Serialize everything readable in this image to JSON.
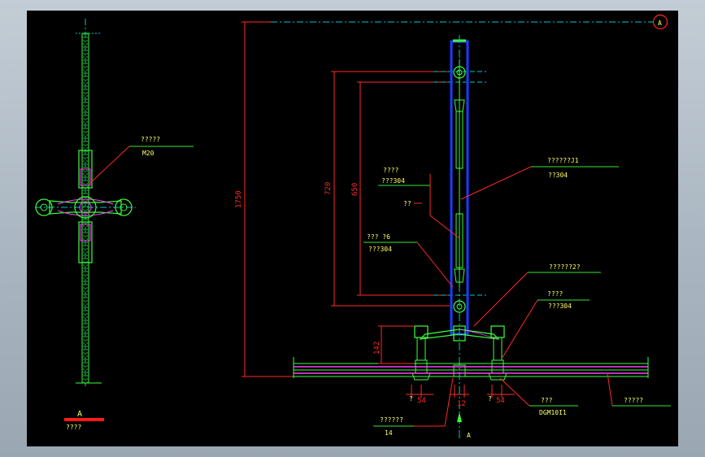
{
  "colors": {
    "background": "#000000",
    "frame": "#b7c2cc",
    "dimension": "#ff2a2a",
    "leader": "#ff2a2a",
    "text": "#ffff66",
    "underline": "#39e639",
    "centerline": "#00c8c8",
    "tube": "#1a3cff",
    "part": "#3cff3c",
    "plate": "#ff3cff"
  },
  "icons": {
    "section_marker": "circle-A-marker"
  },
  "section_marker_label": "A",
  "left_view": {
    "callout": {
      "line1": "?????",
      "line2": "M20"
    },
    "section_letter": "A",
    "section_caption": "????"
  },
  "dimensions": {
    "overall_height": "1750",
    "height_720": "720",
    "height_650": "650",
    "base_height": "142",
    "left_spacing": "54",
    "left_spacing_prefix": "?",
    "right_spacing": "54",
    "right_spacing_prefix": "?",
    "center_gap": "12"
  },
  "callouts": {
    "tube": {
      "line1": "??????J1",
      "line2": "??304"
    },
    "rod": {
      "line1": "????",
      "line2": "???304"
    },
    "rod_extra": "??",
    "clevis": {
      "line1": "???    ?6",
      "line2": "???304"
    },
    "arm": {
      "line1": "??????2?"
    },
    "base": {
      "line1": "????",
      "line2": "???304"
    },
    "bolt": {
      "line1": "???",
      "line2": "DGM10I1"
    },
    "plate": {
      "line1": "?????"
    },
    "bottom": {
      "line1": "??????",
      "line2": "14"
    }
  },
  "bottom_section_label": "A"
}
